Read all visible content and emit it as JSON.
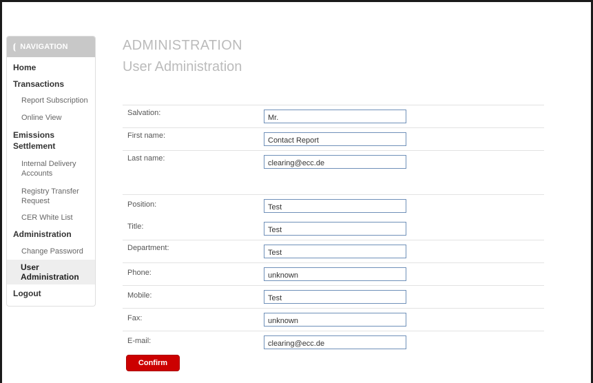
{
  "navigation": {
    "header": "NAVIGATION",
    "icon": "curved-arrow-icon",
    "items": [
      {
        "label": "Home",
        "level": "top"
      },
      {
        "label": "Transactions",
        "level": "top"
      },
      {
        "label": "Report Subscription",
        "level": "sub"
      },
      {
        "label": "Online View",
        "level": "sub"
      },
      {
        "label": "Emissions Settlement",
        "level": "top"
      },
      {
        "label": "Internal Delivery Accounts",
        "level": "sub"
      },
      {
        "label": "Registry Transfer Request",
        "level": "sub"
      },
      {
        "label": "CER White List",
        "level": "sub"
      },
      {
        "label": "Administration",
        "level": "top"
      },
      {
        "label": "Change Password",
        "level": "sub"
      },
      {
        "label": "User Administration",
        "level": "sub",
        "active": true
      },
      {
        "label": "Logout",
        "level": "top"
      }
    ]
  },
  "main": {
    "title": "ADMINISTRATION",
    "subtitle": "User Administration"
  },
  "form": {
    "fields": [
      {
        "label": "Salvation:",
        "value": "Mr."
      },
      {
        "label": "First name:",
        "value": "Contact Report"
      },
      {
        "label": "Last name:",
        "value": "clearing@ecc.de"
      },
      {
        "label": "Position:",
        "value": "Test"
      },
      {
        "label": "Title:",
        "value": "Test"
      },
      {
        "label": "Department:",
        "value": "Test"
      },
      {
        "label": "Phone:",
        "value": "unknown"
      },
      {
        "label": "Mobile:",
        "value": "Test"
      },
      {
        "label": "Fax:",
        "value": "unknown"
      },
      {
        "label": "E-mail:",
        "value": "clearing@ecc.de"
      }
    ],
    "confirm_label": "Confirm"
  },
  "colors": {
    "accent": "#cc0000",
    "nav_header_bg": "#c8c8c8",
    "input_border": "#6e8fb8"
  }
}
